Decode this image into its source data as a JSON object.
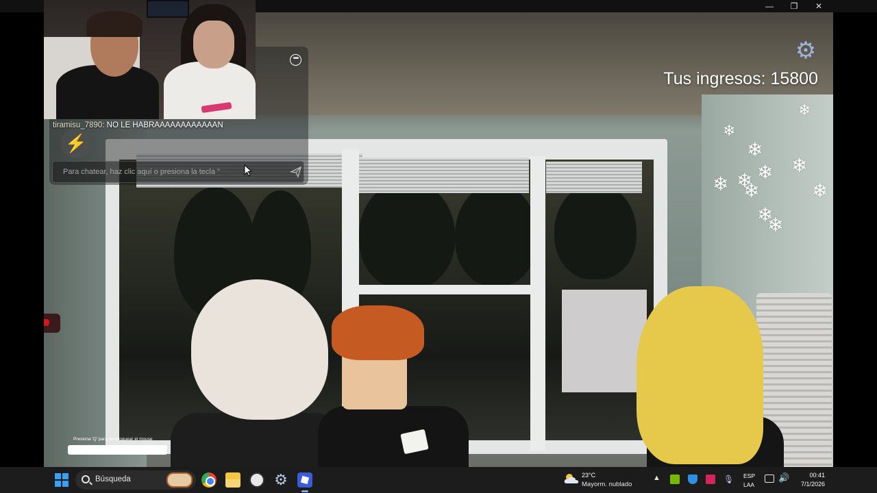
{
  "window": {
    "minimize_glyph": "—",
    "maximize_glyph": "❐",
    "close_glyph": "✕"
  },
  "hud": {
    "earnings": "Tus ingresos: 15800",
    "settings_icon": "gear-icon"
  },
  "chat": {
    "messages": [
      {
        "user": "tiramisu_7890",
        "separator": ":",
        "text": " NO LE HABRAAAAAAAAAAAAN"
      }
    ],
    "input_placeholder": "Para chatear, haz clic aquí o presiona la tecla \"/\".",
    "input_visible_text": "Para chatear, haz clic aquí o presiona la tecla \"",
    "more_icon": "ellipsis-icon",
    "send_icon": "send-icon",
    "emote_icon": "lightning-icon"
  },
  "mouse_lock": {
    "hint": "Presiona 'Q' para desbloquear el mouse"
  },
  "taskbar": {
    "search_label": "Búsqueda",
    "apps": [
      "chrome",
      "file-explorer",
      "obs",
      "settings",
      "roblox"
    ],
    "weather": {
      "temp": "23°C",
      "desc": "Mayorm. nublado"
    },
    "language": [
      "ESP",
      "LAA"
    ],
    "clock": {
      "time": "00:41",
      "date": "7/1/2026"
    }
  },
  "colors": {
    "earnings_text": "#ffffff",
    "accent_blue": "#3aa0f3",
    "chat_bg": "rgba(20,22,24,0.42)"
  }
}
